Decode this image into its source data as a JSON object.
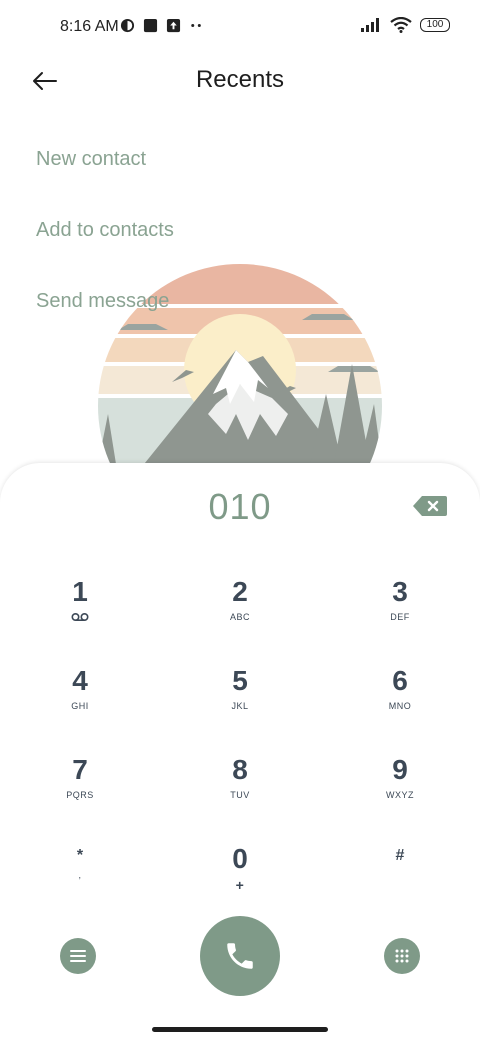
{
  "status_bar": {
    "time": "8:16 AM",
    "left_icons": [
      "theme-icon",
      "square-notification-icon",
      "upload-icon",
      "more-dots-icon"
    ],
    "battery": "100"
  },
  "header": {
    "title": "Recents",
    "back_icon": "back-arrow-icon"
  },
  "actions": [
    {
      "label": "New contact"
    },
    {
      "label": "Add to contacts"
    },
    {
      "label": "Send message"
    }
  ],
  "dialer": {
    "number": "010",
    "keys": [
      {
        "digit": "1",
        "letters": ""
      },
      {
        "digit": "2",
        "letters": "ABC"
      },
      {
        "digit": "3",
        "letters": "DEF"
      },
      {
        "digit": "4",
        "letters": "GHI"
      },
      {
        "digit": "5",
        "letters": "JKL"
      },
      {
        "digit": "6",
        "letters": "MNO"
      },
      {
        "digit": "7",
        "letters": "PQRS"
      },
      {
        "digit": "8",
        "letters": "TUV"
      },
      {
        "digit": "9",
        "letters": "WXYZ"
      },
      {
        "digit": "*",
        "letters": ","
      },
      {
        "digit": "0",
        "letters": "+"
      },
      {
        "digit": "#",
        "letters": ""
      }
    ]
  },
  "colors": {
    "accent": "#7f9a88",
    "key_text": "#3c4856"
  }
}
